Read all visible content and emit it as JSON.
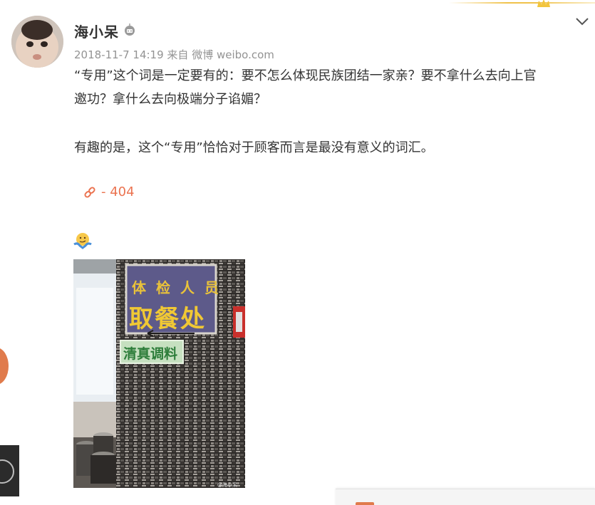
{
  "post": {
    "username": "海小呆",
    "timestamp": "2018-11-7 14:19",
    "source_prefix": "来自",
    "source": "微博 weibo.com",
    "text_line1": "“专用”这个词是一定要有的：要不怎么体现民族团结一家亲？要不拿什么去向上官",
    "text_line2": "邀功？拿什么去向极端分子谄媚？",
    "text_line3": "有趣的是，这个“专用”恰恰对于顾客而言是最没有意义的词汇。",
    "link_text": "- 404",
    "emoji_icon": "shrug-emoji-icon"
  },
  "photo": {
    "sign_line1": "体检人员",
    "sign_line2": "取餐处",
    "sign_line3": "清真调料",
    "watermark": "@海小呆"
  },
  "colors": {
    "accent": "#eb7350",
    "text": "#333333",
    "meta": "#939393"
  }
}
